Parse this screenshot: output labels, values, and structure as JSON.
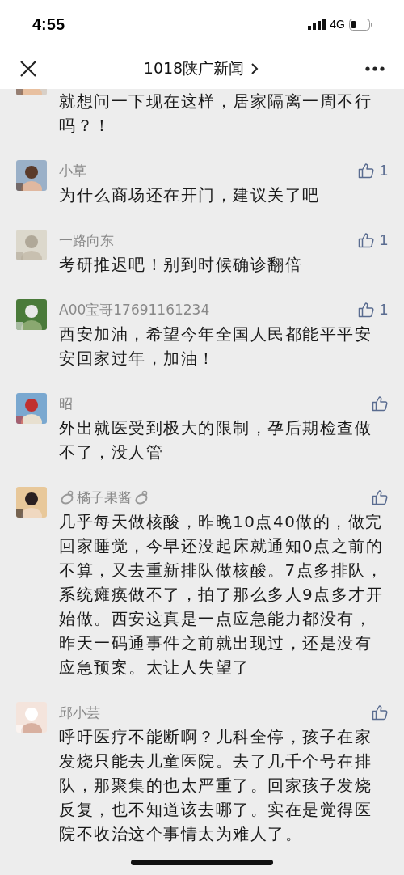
{
  "status_bar": {
    "time": "4:55",
    "network": "4G"
  },
  "nav": {
    "title": "1018陕广新闻"
  },
  "comments": [
    {
      "text": "就想问一下现在这样，居家隔离一周不行吗？！"
    },
    {
      "name": "小草",
      "text": "为什么商场还在开门，建议关了吧",
      "likes": "1"
    },
    {
      "name": "一路向东",
      "text": "考研推迟吧！别到时候确诊翻倍",
      "likes": "1"
    },
    {
      "name": "A00宝哥17691161234",
      "text": "西安加油，希望今年全国人民都能平平安安回家过年，加油！",
      "likes": "1"
    },
    {
      "name": "昭",
      "text": "外出就医受到极大的限制，孕后期检查做不了，没人管"
    },
    {
      "name": "橘子果酱",
      "text": "几乎每天做核酸，昨晚10点40做的，做完回家睡觉，今早还没起床就通知0点之前的不算，又去重新排队做核酸。7点多排队，系统瘫痪做不了，拍了那么多人9点多才开始做。西安这真是一点应急能力都没有，昨天一码通事件之前就出现过，还是没有应急预案。太让人失望了",
      "decorated": true
    },
    {
      "name": "邱小芸",
      "text": "呼吁医疗不能断啊？儿科全停，孩子在家发烧只能去儿童医院。去了几千个号在排队，那聚集的也太严重了。回家孩子发烧反复，也不知道该去哪了。实在是觉得医院不收治这个事情太为难人了。"
    }
  ]
}
